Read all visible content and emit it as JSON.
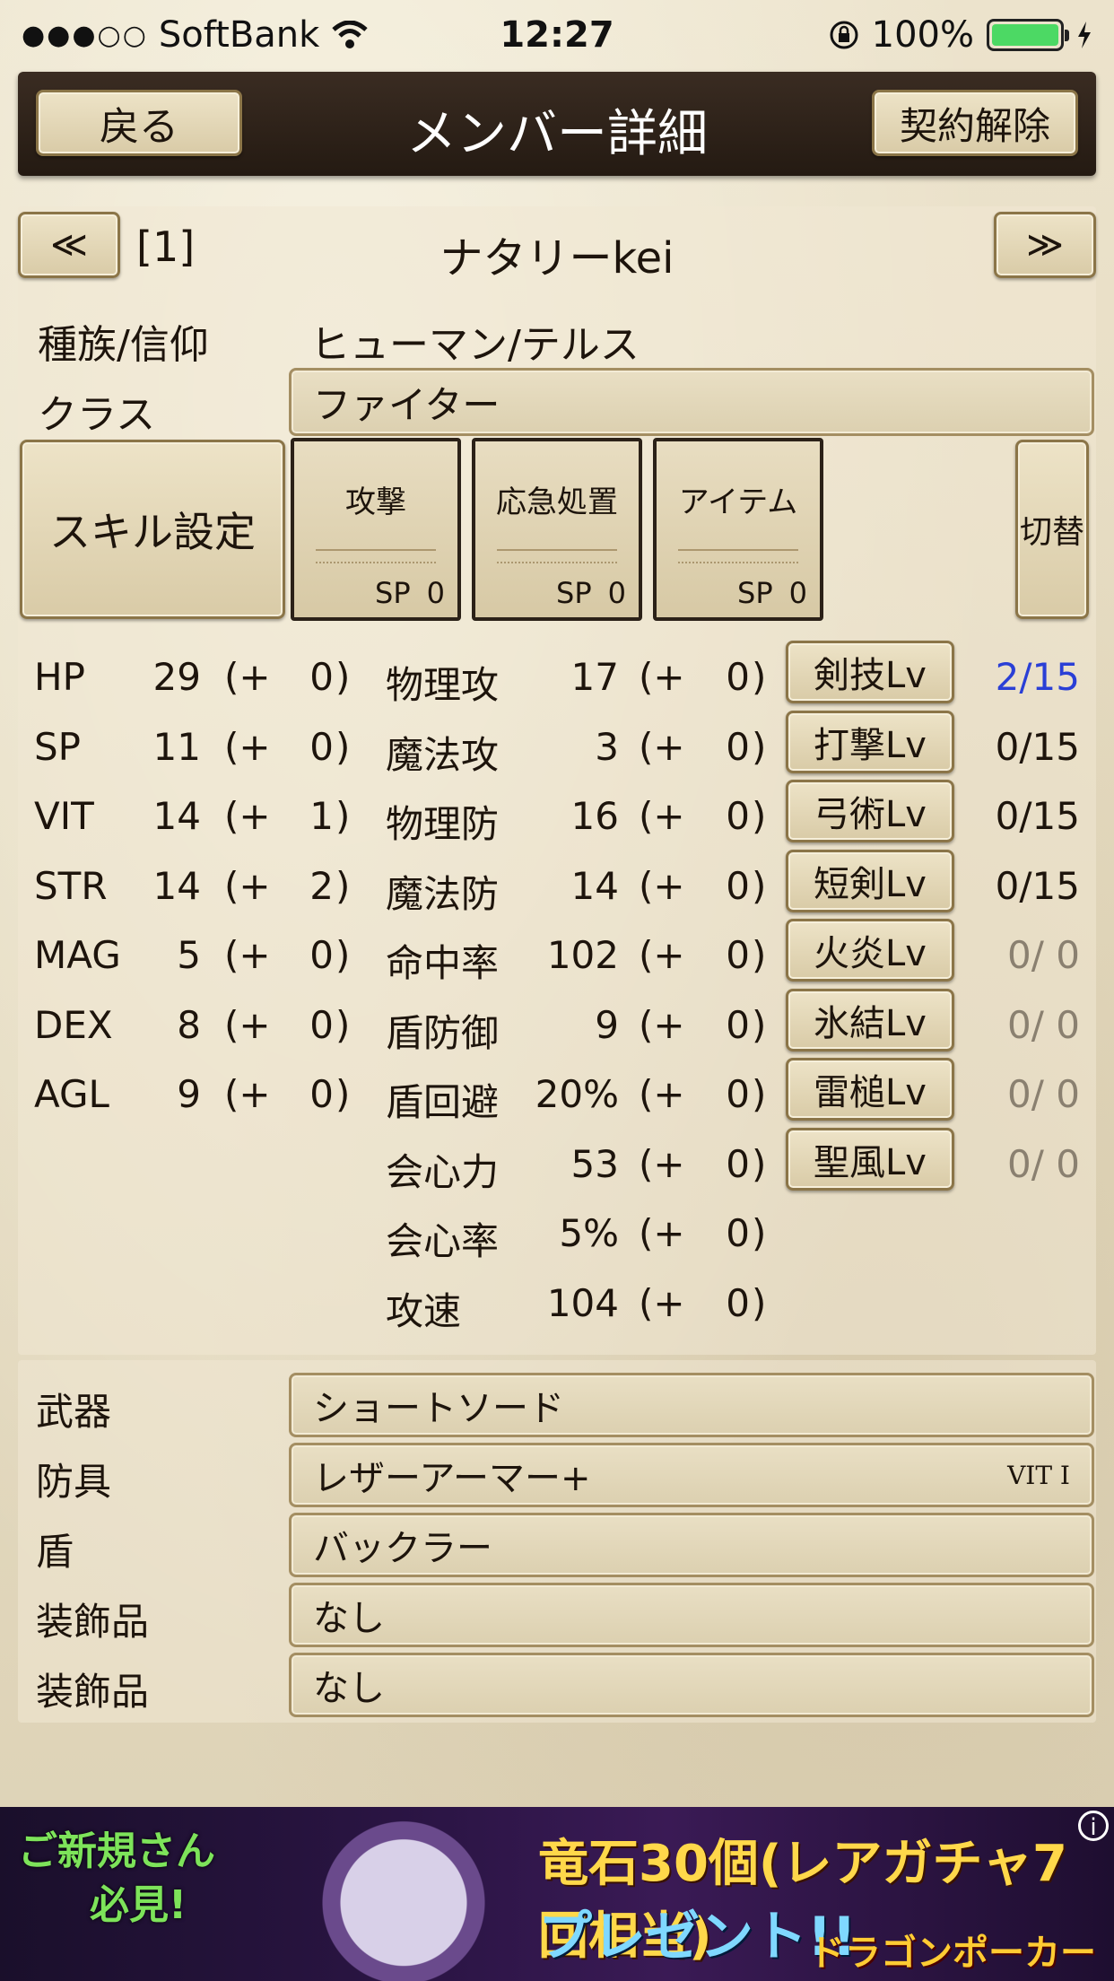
{
  "status_bar": {
    "signal": "●●●○○",
    "carrier": "SoftBank",
    "time": "12:27",
    "battery_text": "100%",
    "battery_level": 1.0
  },
  "header": {
    "back_label": "戻る",
    "title": "メンバー詳細",
    "dismiss_label": "契約解除"
  },
  "member": {
    "prev_label": "≪",
    "next_label": "≫",
    "slot": "[1]",
    "name": "ナタリーkei",
    "race_label": "種族/信仰",
    "race_value": "ヒューマン/テルス",
    "class_label": "クラス",
    "class_value": "ファイター"
  },
  "skills": {
    "setting_label": "スキル設定",
    "switch_label": "切替",
    "slots": [
      {
        "name": "攻撃",
        "sp_label": "SP",
        "sp": "0"
      },
      {
        "name": "応急処置",
        "sp_label": "SP",
        "sp": "0"
      },
      {
        "name": "アイテム",
        "sp_label": "SP",
        "sp": "0"
      }
    ]
  },
  "base_stats": [
    {
      "name": "HP",
      "value": "29",
      "bonus": "0"
    },
    {
      "name": "SP",
      "value": "11",
      "bonus": "0"
    },
    {
      "name": "VIT",
      "value": "14",
      "bonus": "1"
    },
    {
      "name": "STR",
      "value": "14",
      "bonus": "2"
    },
    {
      "name": "MAG",
      "value": "5",
      "bonus": "0"
    },
    {
      "name": "DEX",
      "value": "8",
      "bonus": "0"
    },
    {
      "name": "AGL",
      "value": "9",
      "bonus": "0"
    }
  ],
  "combat_stats": [
    {
      "name": "物理攻",
      "value": "17",
      "bonus": "0"
    },
    {
      "name": "魔法攻",
      "value": "3",
      "bonus": "0"
    },
    {
      "name": "物理防",
      "value": "16",
      "bonus": "0"
    },
    {
      "name": "魔法防",
      "value": "14",
      "bonus": "0"
    },
    {
      "name": "命中率",
      "value": "102",
      "bonus": "0"
    },
    {
      "name": "盾防御",
      "value": "9",
      "bonus": "0"
    },
    {
      "name": "盾回避",
      "value": "20%",
      "bonus": "0"
    },
    {
      "name": "会心力",
      "value": "53",
      "bonus": "0"
    },
    {
      "name": "会心率",
      "value": "5%",
      "bonus": "0"
    },
    {
      "name": "攻速",
      "value": "104",
      "bonus": "0"
    }
  ],
  "skill_levels": [
    {
      "label": "剣技Lv",
      "value": "2/15",
      "color": "#2a3fd6"
    },
    {
      "label": "打撃Lv",
      "value": "0/15",
      "color": "#1d140c"
    },
    {
      "label": "弓術Lv",
      "value": "0/15",
      "color": "#1d140c"
    },
    {
      "label": "短剣Lv",
      "value": "0/15",
      "color": "#1d140c"
    },
    {
      "label": "火炎Lv",
      "value": "0/ 0",
      "color": "#8a8070"
    },
    {
      "label": "氷結Lv",
      "value": "0/ 0",
      "color": "#8a8070"
    },
    {
      "label": "雷槌Lv",
      "value": "0/ 0",
      "color": "#8a8070"
    },
    {
      "label": "聖風Lv",
      "value": "0/ 0",
      "color": "#8a8070"
    }
  ],
  "equipment": [
    {
      "slot": "武器",
      "item": "ショートソード",
      "note": ""
    },
    {
      "slot": "防具",
      "item": "レザーアーマー+",
      "note": "VIT I"
    },
    {
      "slot": "盾",
      "item": "バックラー",
      "note": ""
    },
    {
      "slot": "装飾品",
      "item": "なし",
      "note": ""
    },
    {
      "slot": "装飾品",
      "item": "なし",
      "note": ""
    }
  ],
  "ad": {
    "left_line1": "ご新規さん",
    "left_line2": "必見!",
    "main": "竜石30個(レアガチャ7回相当)",
    "sub": "プレゼント!!",
    "brand": "ドラゴンポーカー",
    "info": "i"
  }
}
